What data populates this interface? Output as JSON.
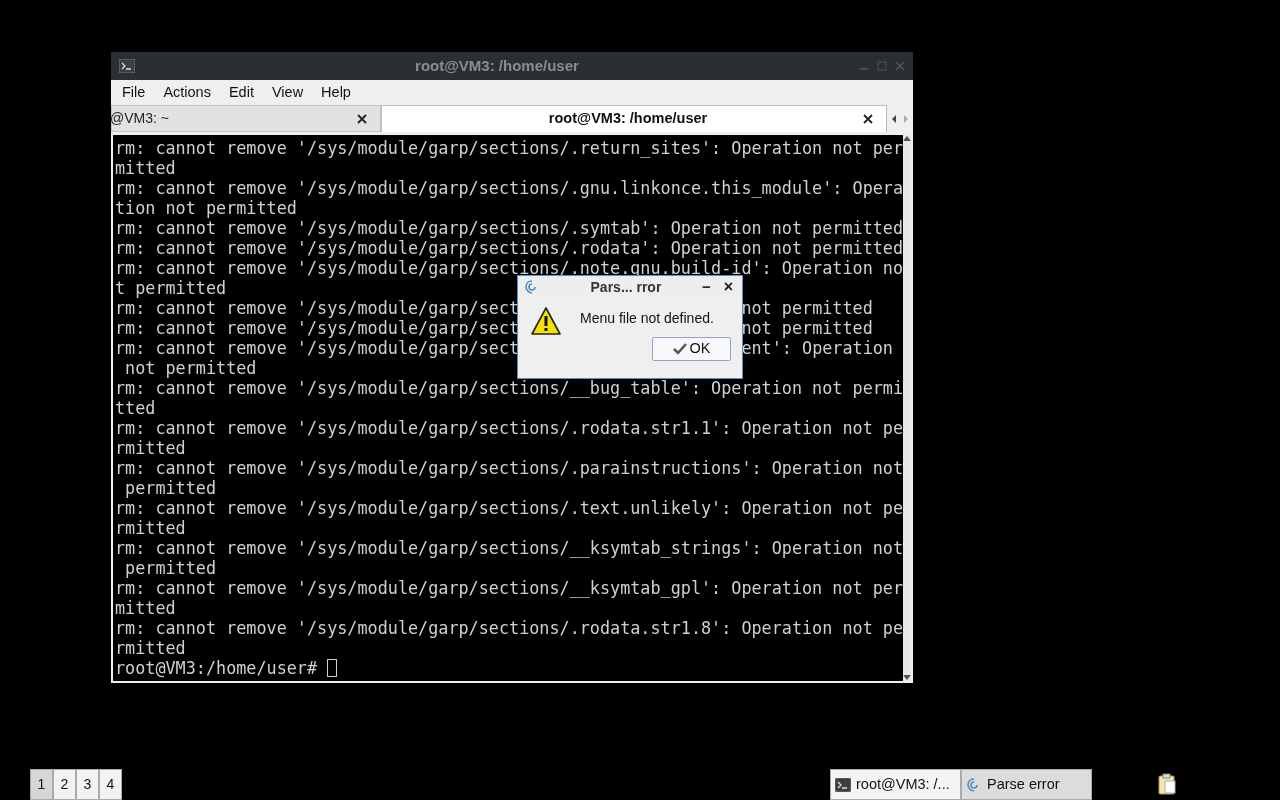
{
  "window": {
    "title": "root@VM3: /home/user"
  },
  "menu": [
    "File",
    "Actions",
    "Edit",
    "View",
    "Help"
  ],
  "tabs": [
    {
      "label": "@VM3: ~",
      "selected": false
    },
    {
      "label": "root@VM3: /home/user",
      "selected": true
    }
  ],
  "terminal": {
    "rows": [
      {
        "text": "rm: cannot remove '/sys/module/garp/sections/.return_sites': Operation not per"
      },
      {
        "text": "mitted"
      },
      {
        "text": "rm: cannot remove '/sys/module/garp/sections/.gnu.linkonce.this_module': Opera"
      },
      {
        "text": "tion not permitted"
      },
      {
        "text": "rm: cannot remove '/sys/module/garp/sections/.symtab': Operation not permitted"
      },
      {
        "text": "rm: cannot remove '/sys/module/garp/sections/.rodata': Operation not permitted"
      },
      {
        "text": "rm: cannot remove '/sys/module/garp/sections/.note.gnu.build-id': Operation no"
      },
      {
        "text": "t permitted"
      },
      {
        "text": "rm: cannot remove '/sys/module/garp/sect",
        "tail": "not permitted"
      },
      {
        "text": "rm: cannot remove '/sys/module/garp/sect",
        "tail": "not permitted"
      },
      {
        "text": "rm: cannot remove '/sys/module/garp/sect",
        "tail": "ent': Operation"
      },
      {
        "text": " not permitted"
      },
      {
        "text": "rm: cannot remove '/sys/module/garp/sections/__bug_table': Operation not permi"
      },
      {
        "text": "tted"
      },
      {
        "text": "rm: cannot remove '/sys/module/garp/sections/.rodata.str1.1': Operation not pe"
      },
      {
        "text": "rmitted"
      },
      {
        "text": "rm: cannot remove '/sys/module/garp/sections/.parainstructions': Operation not"
      },
      {
        "text": " permitted"
      },
      {
        "text": "rm: cannot remove '/sys/module/garp/sections/.text.unlikely': Operation not pe"
      },
      {
        "text": "rmitted"
      },
      {
        "text": "rm: cannot remove '/sys/module/garp/sections/__ksymtab_strings': Operation not"
      },
      {
        "text": " permitted"
      },
      {
        "text": "rm: cannot remove '/sys/module/garp/sections/__ksymtab_gpl': Operation not per"
      },
      {
        "text": "mitted"
      },
      {
        "text": "rm: cannot remove '/sys/module/garp/sections/.rodata.str1.8': Operation not pe"
      },
      {
        "text": "rmitted"
      }
    ],
    "prompt": "root@VM3:/home/user# "
  },
  "dialog": {
    "title": "Pars... rror",
    "minimize": "−",
    "close": "×",
    "message": "Menu file not defined.",
    "button": "OK"
  },
  "taskbar": {
    "workspaces": [
      {
        "label": "1",
        "selected": true
      },
      {
        "label": "2",
        "selected": false
      },
      {
        "label": "3",
        "selected": false
      },
      {
        "label": "4",
        "selected": false
      }
    ],
    "tasks": [
      {
        "label": "root@VM3: /...",
        "kind": "terminal"
      },
      {
        "label": "Parse error",
        "kind": "dialog"
      }
    ]
  }
}
